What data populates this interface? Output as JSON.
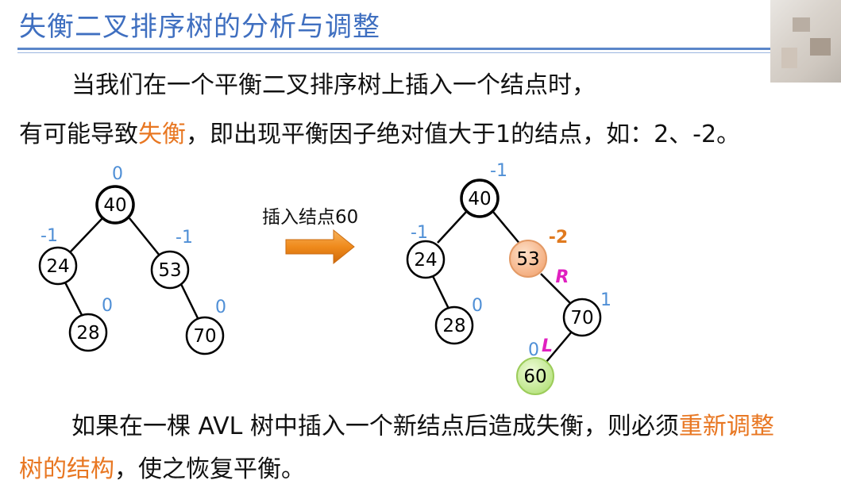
{
  "title": "失衡二叉排序树的分析与调整",
  "intro": {
    "line1": "当我们在一个平衡二叉排序树上插入一个结点时，",
    "line2_pre": "有可能导致",
    "line2_hl": "失衡",
    "line2_post": "，即出现平衡因子绝对值大于1的结点，如：2、-2。"
  },
  "arrow_label": "插入结点60",
  "tree_before": {
    "nodes": [
      {
        "key": "40",
        "bf": "0"
      },
      {
        "key": "24",
        "bf": "-1"
      },
      {
        "key": "53",
        "bf": "-1"
      },
      {
        "key": "28",
        "bf": "0"
      },
      {
        "key": "70",
        "bf": "0"
      }
    ]
  },
  "tree_after": {
    "nodes": [
      {
        "key": "40",
        "bf": "-1"
      },
      {
        "key": "24",
        "bf": "-1"
      },
      {
        "key": "53",
        "bf": "-2"
      },
      {
        "key": "28",
        "bf": "0"
      },
      {
        "key": "70",
        "bf": "1"
      },
      {
        "key": "60",
        "bf": "0"
      }
    ],
    "rotation_labels": [
      "R",
      "L"
    ]
  },
  "conclusion": {
    "line1_pre": "如果在一棵 AVL 树中插入一个新结点后造成失衡，则必须",
    "line1_hl": "重新调整",
    "line2_hl": "树的结构",
    "line2_post": "，使之恢复平衡。"
  },
  "colors": {
    "title": "#3f6fc0",
    "highlight": "#e87722",
    "balance_factor": "#4f8fd6",
    "unbalanced_node": "#f6b98a",
    "new_node": "#c8ec9a",
    "rotation_label": "#e020c0"
  }
}
